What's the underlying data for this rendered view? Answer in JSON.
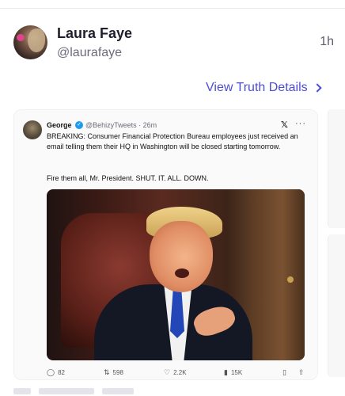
{
  "post": {
    "author_name": "Laura Faye",
    "author_handle": "@laurafaye",
    "time": "1h",
    "view_details_label": "View Truth Details"
  },
  "embedded_tweet": {
    "name": "George",
    "handle_time": "@BehizyTweets · 26m",
    "x_logo": "𝕏",
    "more": "···",
    "text": "BREAKING: Consumer Financial Protection Bureau employees just received an email telling them their HQ in Washington will be closed starting tomorrow.",
    "text2": "Fire them all, Mr. President. SHUT. IT. ALL. DOWN.",
    "stats": {
      "replies": "82",
      "reposts": "598",
      "likes": "2.2K",
      "views": "15K"
    }
  },
  "icons": {
    "reply": "comment-icon",
    "repost": "repost-icon",
    "like": "heart-icon",
    "views": "views-icon",
    "bookmark": "bookmark-icon",
    "share": "share-icon"
  },
  "colors": {
    "accent": "#4c4cd6",
    "verified": "#1d9bf0"
  }
}
